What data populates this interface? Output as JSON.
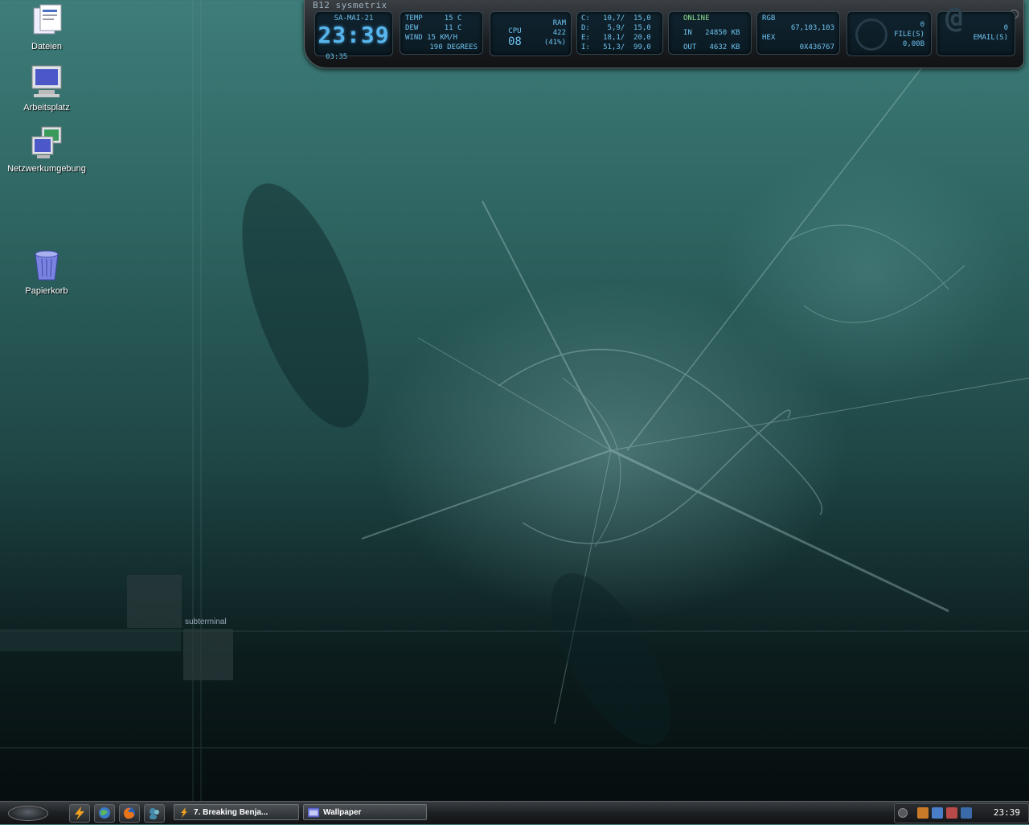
{
  "desktop": {
    "icons": [
      {
        "label": "Dateien"
      },
      {
        "label": "Arbeitsplatz"
      },
      {
        "label": "Netzwerkumgebung"
      },
      {
        "label": "Papierkorb"
      }
    ]
  },
  "sysmetrix": {
    "brand": "B12 sysmetrix",
    "clock": {
      "date": "SA-MAI-21",
      "time": "23:39",
      "sub": "03:35"
    },
    "weather": {
      "temp": "TEMP     15 C",
      "dew": "DEW      11 C",
      "wind": "WIND 15 KM/H",
      "dir": "190 DEGREES"
    },
    "cpu": {
      "label": "CPU",
      "value": "08",
      "ram_label": "RAM",
      "ram_value": "422",
      "ram_pct": "(41%)"
    },
    "drives": [
      "C:   10,7/  15,0",
      "D:    5,9/  15,0",
      "E:   18,1/  20,0",
      "I:   51,3/  99,0"
    ],
    "net": {
      "status": "ONLINE",
      "in": "IN   24850 KB",
      "out": "OUT   4632 KB"
    },
    "color": {
      "label": "RGB",
      "rgb": "67,103,103",
      "hex_label": "HEX",
      "hex": "0X436767"
    },
    "recycle": {
      "count": "0",
      "files": "FILE(S)",
      "size": "0,00B"
    },
    "email": {
      "count": "0",
      "label": "EMAIL(S)"
    }
  },
  "wallpaper": {
    "text": "subterminal"
  },
  "taskbar": {
    "tasks": [
      {
        "label": "7. Breaking Benja..."
      },
      {
        "label": "Wallpaper"
      }
    ],
    "clock": "23:39"
  },
  "colors": {
    "accent": "#58b6ee",
    "desktop": "#436767"
  }
}
